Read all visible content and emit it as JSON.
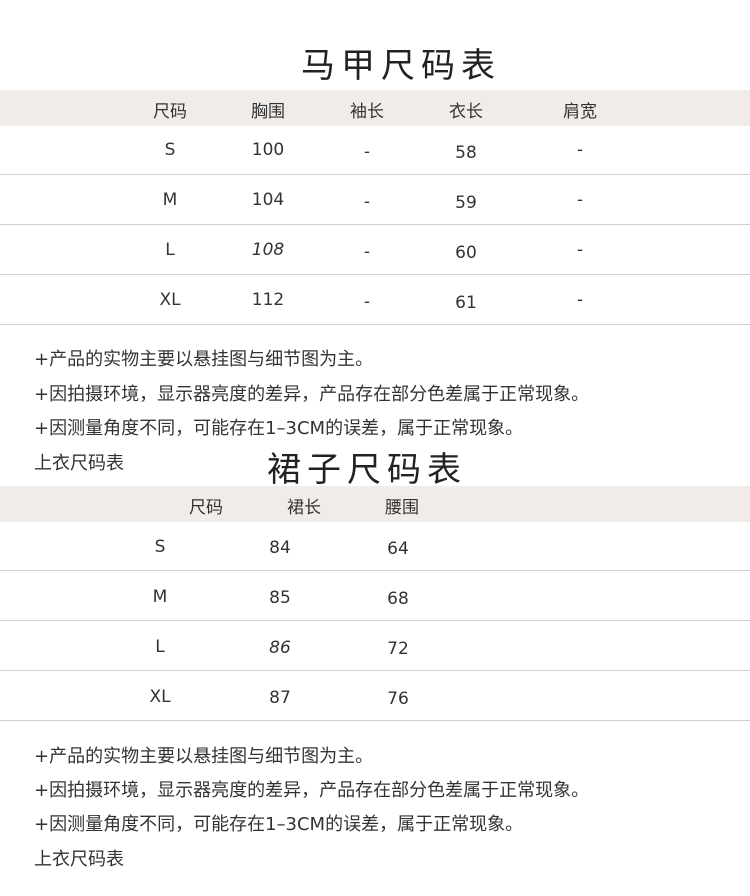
{
  "vest_table": {
    "title": "马甲尺码表",
    "headers": [
      "尺码",
      "胸围",
      "袖长",
      "衣长",
      "肩宽"
    ],
    "rows": [
      [
        "S",
        "100",
        "-",
        "58",
        "-"
      ],
      [
        "M",
        "104",
        "-",
        "59",
        "-"
      ],
      [
        "L",
        "108",
        "-",
        "60",
        "-"
      ],
      [
        "XL",
        "112",
        "-",
        "61",
        "-"
      ]
    ]
  },
  "notes_1": [
    "+产品的实物主要以悬挂图与细节图为主。",
    "+因拍摄环境，显示器亮度的差异，产品存在部分色差属于正常现象。",
    "+因测量角度不同，可能存在1–3CM的误差，属于正常现象。"
  ],
  "section_label_1": "上衣尺码表",
  "skirt_table": {
    "title": "裙子尺码表",
    "headers": [
      "尺码",
      "裙长",
      "腰围"
    ],
    "rows": [
      [
        "S",
        "84",
        "64"
      ],
      [
        "M",
        "85",
        "68"
      ],
      [
        "L",
        "86",
        "72"
      ],
      [
        "XL",
        "87",
        "76"
      ]
    ]
  },
  "notes_2": [
    "+产品的实物主要以悬挂图与细节图为主。",
    "+因拍摄环境，显示器亮度的差异，产品存在部分色差属于正常现象。",
    "+因测量角度不同，可能存在1–3CM的误差，属于正常现象。"
  ],
  "section_label_2": "上衣尺码表"
}
